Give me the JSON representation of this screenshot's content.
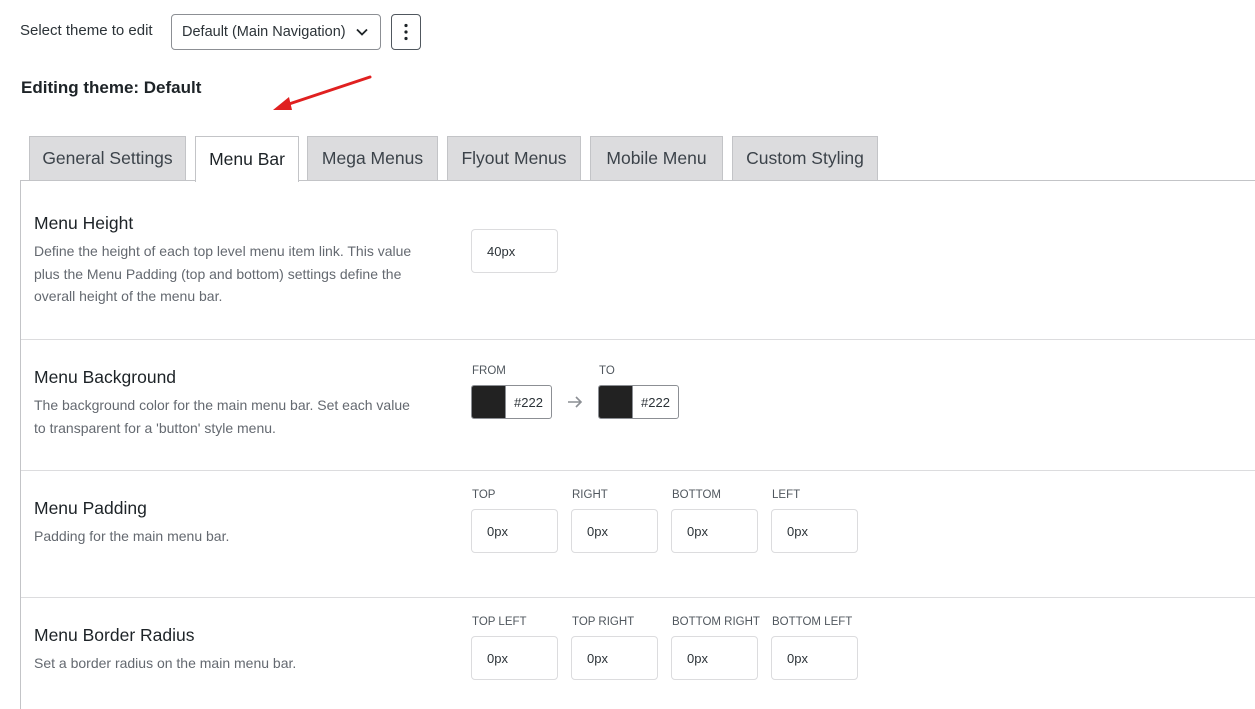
{
  "header": {
    "select_label": "Select theme to edit",
    "select_value": "Default (Main Navigation)",
    "editing_title": "Editing theme: Default"
  },
  "tabs": [
    {
      "label": "General Settings",
      "active": false
    },
    {
      "label": "Menu Bar",
      "active": true
    },
    {
      "label": "Mega Menus",
      "active": false
    },
    {
      "label": "Flyout Menus",
      "active": false
    },
    {
      "label": "Mobile Menu",
      "active": false
    },
    {
      "label": "Custom Styling",
      "active": false
    }
  ],
  "settings": {
    "menu_height": {
      "title": "Menu Height",
      "description": "Define the height of each top level menu item link. This value plus the Menu Padding (top and bottom) settings define the overall height of the menu bar.",
      "value": "40px"
    },
    "menu_background": {
      "title": "Menu Background",
      "description": "The background color for the main menu bar. Set each value to transparent for a 'button' style menu.",
      "from_label": "FROM",
      "from_value": "#222",
      "to_label": "TO",
      "to_value": "#222",
      "swatch_color": "#222222"
    },
    "menu_padding": {
      "title": "Menu Padding",
      "description": "Padding for the main menu bar.",
      "fields": [
        {
          "label": "TOP",
          "value": "0px"
        },
        {
          "label": "RIGHT",
          "value": "0px"
        },
        {
          "label": "BOTTOM",
          "value": "0px"
        },
        {
          "label": "LEFT",
          "value": "0px"
        }
      ]
    },
    "menu_border_radius": {
      "title": "Menu Border Radius",
      "description": "Set a border radius on the main menu bar.",
      "fields": [
        {
          "label": "TOP LEFT",
          "value": "0px"
        },
        {
          "label": "TOP RIGHT",
          "value": "0px"
        },
        {
          "label": "BOTTOM RIGHT",
          "value": "0px"
        },
        {
          "label": "BOTTOM LEFT",
          "value": "0px"
        }
      ]
    }
  },
  "icons": {
    "select_chevron": "chevron-down-icon",
    "more_menu": "vertical-ellipsis-icon",
    "annotation_arrow": "red-arrow-icon",
    "color_to_arrow": "right-arrow-icon"
  },
  "colors": {
    "annotation_arrow": "#e02020",
    "swatch": "#222222"
  }
}
